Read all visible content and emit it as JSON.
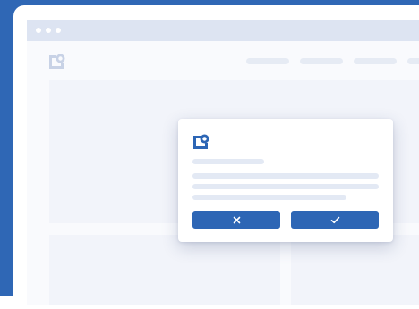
{
  "colors": {
    "background": "#2f67b5",
    "frame": "#ffffff",
    "page": "#f9fafd",
    "titlebar": "#dde4f2",
    "placeholder": "#e6ebf4",
    "panel": "#f2f4fa",
    "logo": "#c8d2e6",
    "accent": "#2d66b5",
    "modal_line": "#e3e9f4",
    "modal": "#ffffff"
  },
  "icons": {
    "window_controls": "dot-icon",
    "logo": "logo-icon",
    "cancel": "close-icon",
    "confirm": "check-icon"
  },
  "dialog": {
    "buttons": [
      "cancel",
      "confirm"
    ]
  }
}
